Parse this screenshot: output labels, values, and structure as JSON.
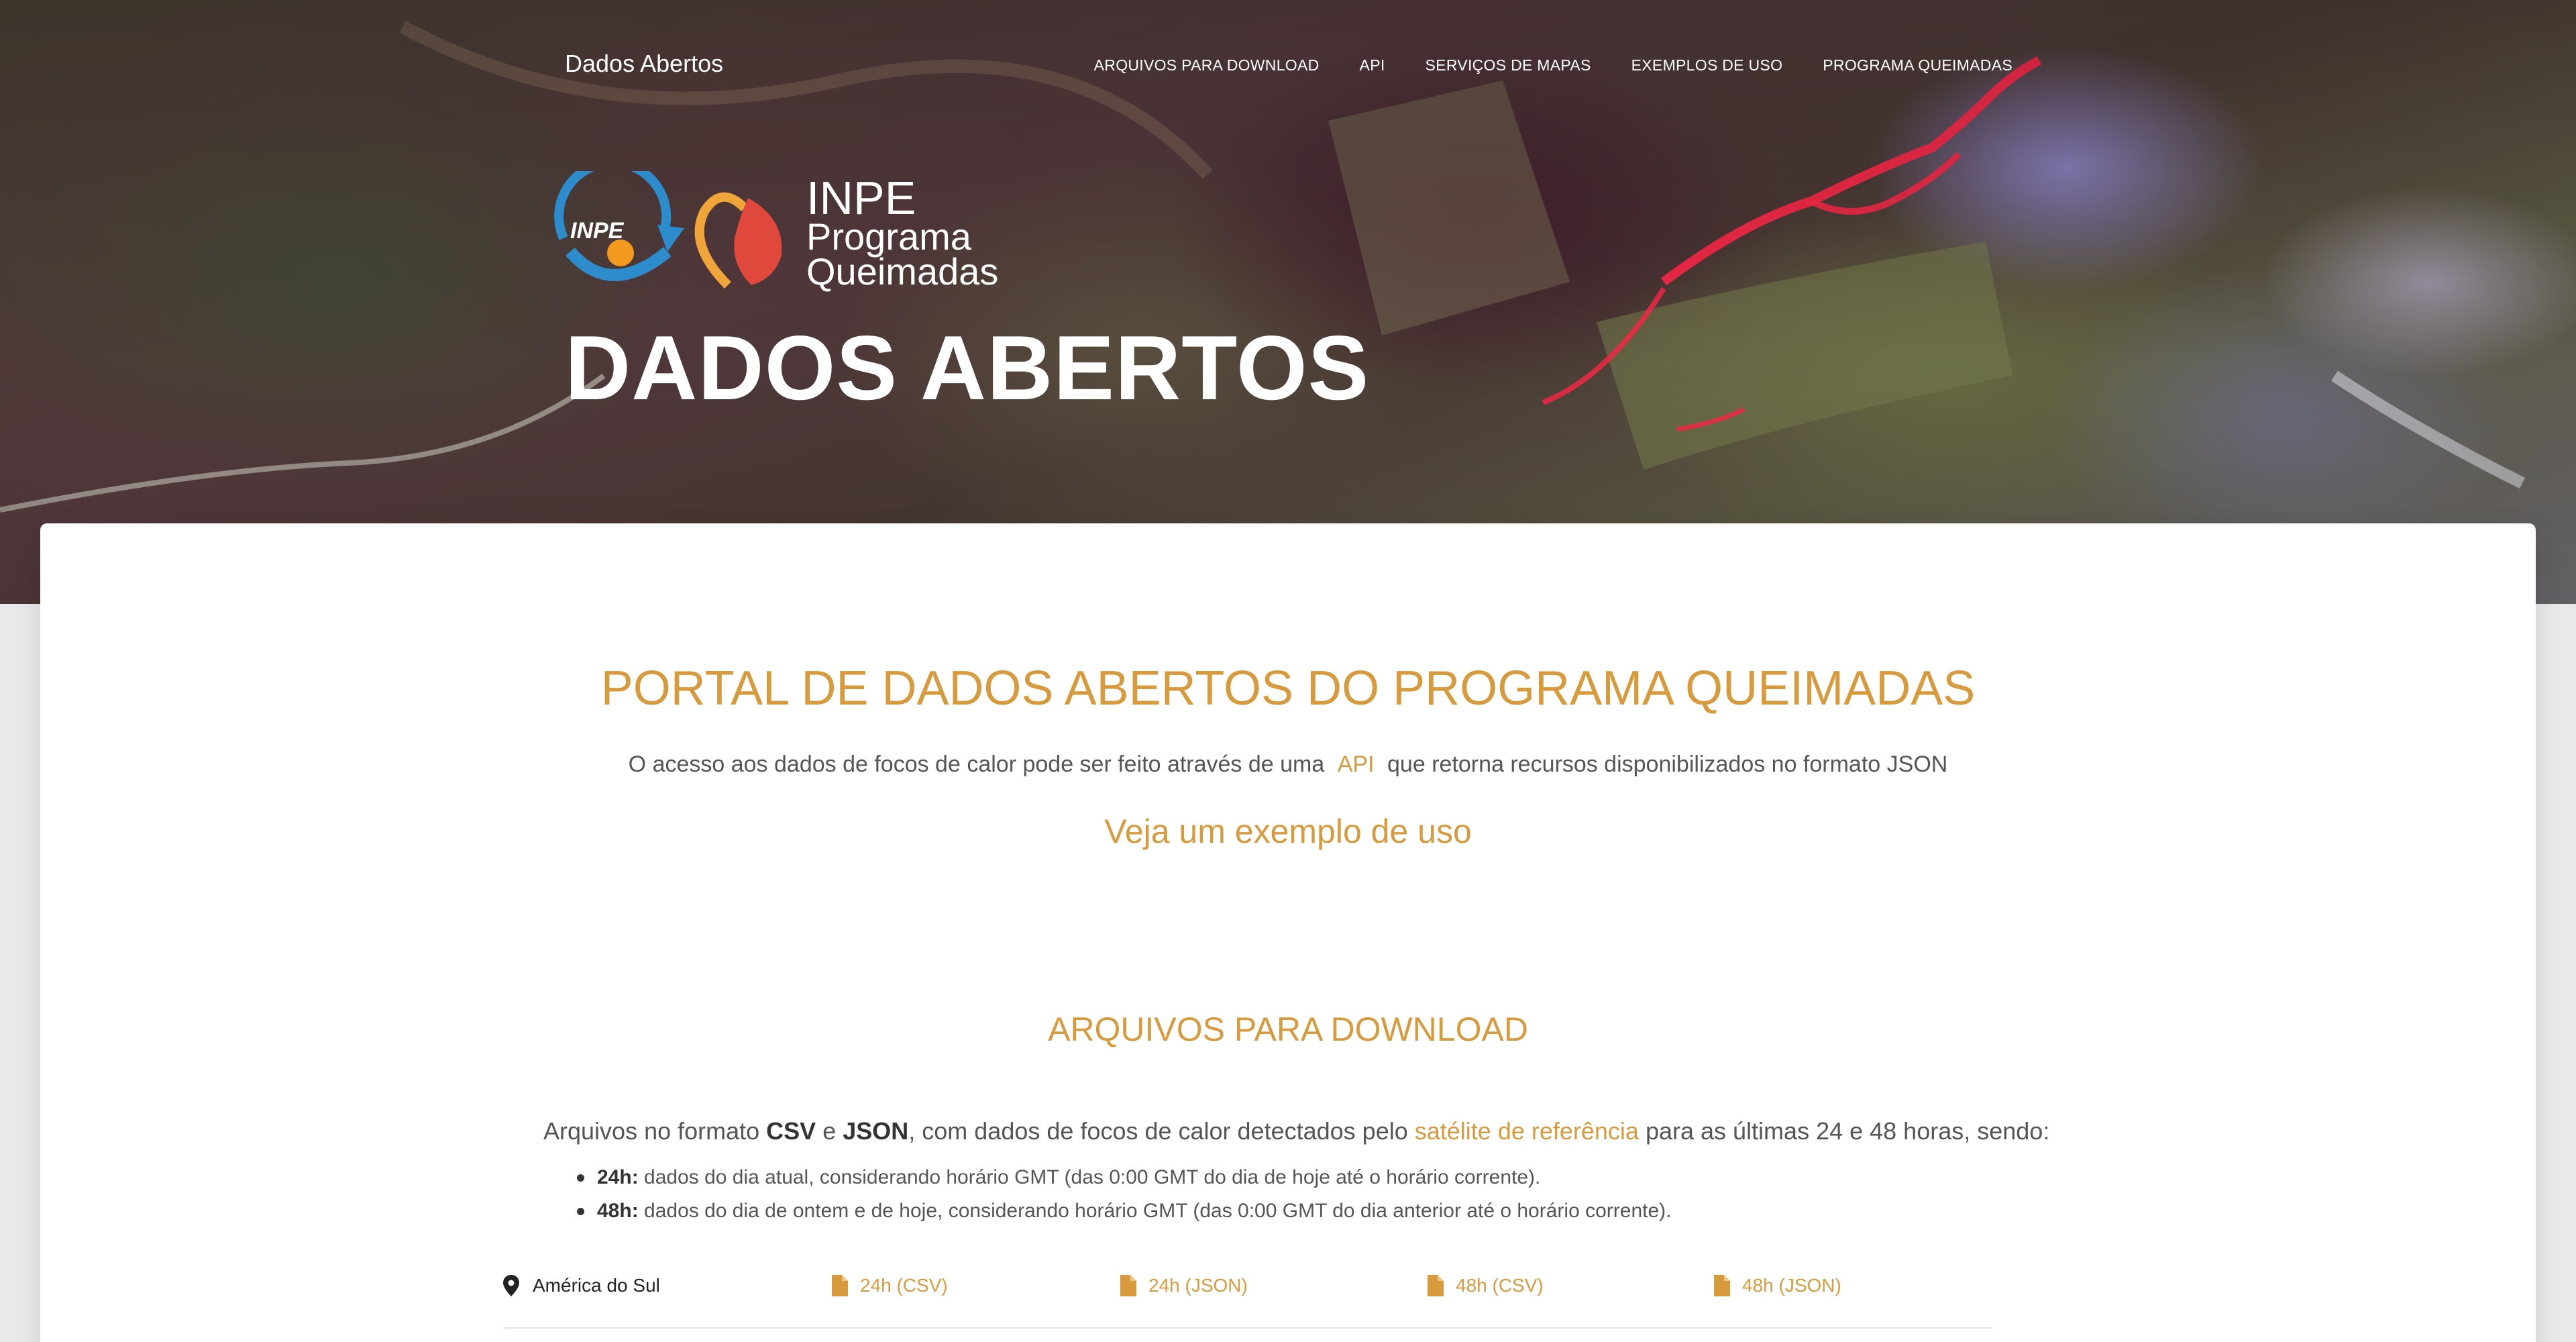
{
  "nav": {
    "brand": "Dados Abertos",
    "items": [
      {
        "label": "ARQUIVOS PARA DOWNLOAD"
      },
      {
        "label": "API"
      },
      {
        "label": "SERVIÇOS DE MAPAS"
      },
      {
        "label": "EXEMPLOS DE USO"
      },
      {
        "label": "PROGRAMA QUEIMADAS"
      }
    ]
  },
  "logo": {
    "inpe_badge": "INPE",
    "line1": "INPE",
    "line2": "Programa",
    "line3": "Queimadas"
  },
  "hero": {
    "title": "DADOS ABERTOS"
  },
  "portal": {
    "title": "PORTAL DE DADOS ABERTOS DO PROGRAMA QUEIMADAS",
    "sub_before": "O acesso aos dados de focos de calor pode ser feito através de uma",
    "sub_link": "API",
    "sub_after": "que retorna recursos disponibilizados no formato JSON",
    "example_link": "Veja um exemplo de uso"
  },
  "downloads": {
    "title": "ARQUIVOS PARA DOWNLOAD",
    "intro_1": "Arquivos no formato ",
    "intro_csv": "CSV",
    "intro_2": " e ",
    "intro_json": "JSON",
    "intro_3": ", com dados de focos de calor detectados pelo ",
    "intro_link": "satélite de referência",
    "intro_4": " para as últimas 24 e 48 horas, sendo:",
    "bullets": [
      {
        "label": "24h:",
        "text": " dados do dia atual, considerando horário GMT (das 0:00 GMT do dia de hoje até o horário corrente)."
      },
      {
        "label": "48h:",
        "text": " dados do dia de ontem e de hoje, considerando horário GMT (das 0:00 GMT do dia anterior até o horário corrente)."
      }
    ],
    "row": {
      "region": "América do Sul",
      "links": [
        "24h (CSV)",
        "24h (JSON)",
        "48h (CSV)",
        "48h (JSON)"
      ]
    }
  },
  "colors": {
    "accent": "#d79a3c",
    "text": "#555555"
  }
}
